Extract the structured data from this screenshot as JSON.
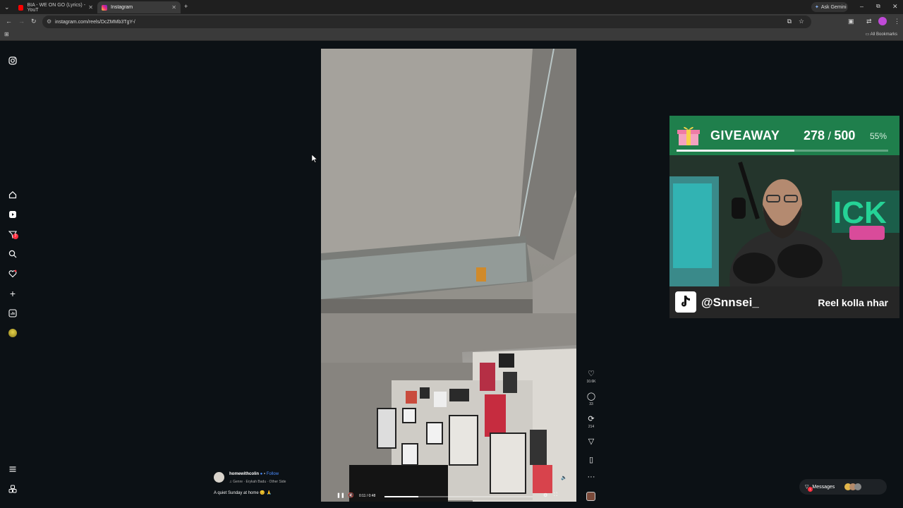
{
  "browser": {
    "tabs": [
      {
        "title": "BIA - WE ON GO (Lyrics) - YouT",
        "active": false,
        "favicon_color": "#ff0000"
      },
      {
        "title": "Instagram",
        "active": true,
        "favicon_color": "#d62976"
      }
    ],
    "url": "instagram.com/reels/DcZMMb3TgY-/",
    "ask_gemini": "Ask Gemini",
    "all_bookmarks": "All Bookmarks"
  },
  "sidebar": {
    "items": [
      {
        "icon": "instagram-logo-icon"
      },
      {
        "icon": "home-icon"
      },
      {
        "icon": "reels-icon"
      },
      {
        "icon": "direct-messages-icon",
        "badge": "7"
      },
      {
        "icon": "search-icon"
      },
      {
        "icon": "notifications-heart-icon"
      },
      {
        "icon": "create-plus-icon"
      },
      {
        "icon": "dashboard-icon"
      },
      {
        "icon": "profile-avatar-icon"
      },
      {
        "icon": "more-menu-icon"
      },
      {
        "icon": "also-from-meta-icon"
      }
    ]
  },
  "reel": {
    "username": "homewithcolin",
    "follow_label": "Follow",
    "audio": "Genre · Erykah Badu · Other Side",
    "caption": "A quiet Sunday at home 😊 🙏",
    "time": "0:11 / 0:48",
    "progress": 0.23,
    "likes": "10.6K",
    "comments": "33",
    "reposts": "214"
  },
  "messages": {
    "label": "Messages",
    "badge": "7"
  },
  "overlay": {
    "giveaway_label": "GIVEAWAY",
    "count": "278",
    "total": "500",
    "percent": "55%",
    "progress": 0.556,
    "handle": "@Snnsei_",
    "tagline": "Reel kolla nhar"
  },
  "colors": {
    "giveaway_green": "#1f7f4c",
    "page_bg": "#0c1115",
    "follow_blue": "#4a8cff"
  }
}
